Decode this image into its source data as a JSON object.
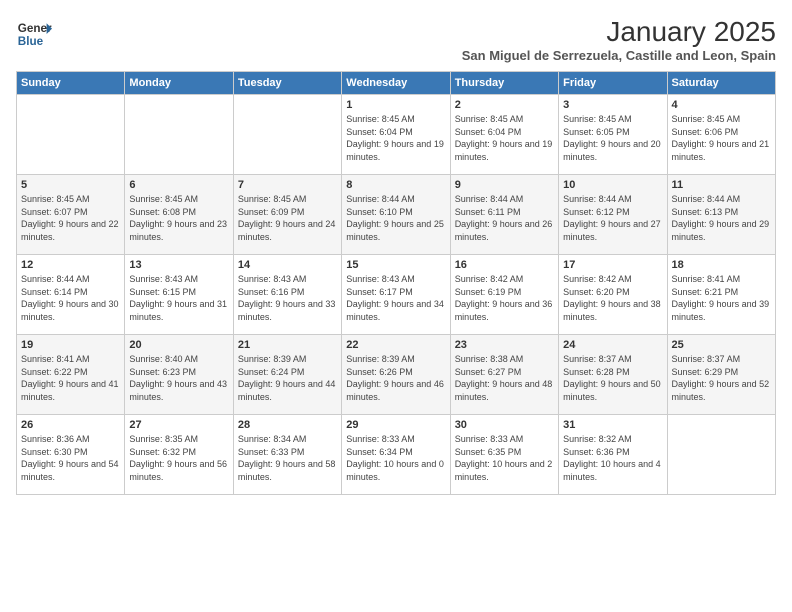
{
  "header": {
    "logo_line1": "General",
    "logo_line2": "Blue",
    "month_title": "January 2025",
    "subtitle": "San Miguel de Serrezuela, Castille and Leon, Spain"
  },
  "days_of_week": [
    "Sunday",
    "Monday",
    "Tuesday",
    "Wednesday",
    "Thursday",
    "Friday",
    "Saturday"
  ],
  "weeks": [
    [
      {
        "day": "",
        "info": ""
      },
      {
        "day": "",
        "info": ""
      },
      {
        "day": "",
        "info": ""
      },
      {
        "day": "1",
        "info": "Sunrise: 8:45 AM\nSunset: 6:04 PM\nDaylight: 9 hours and 19 minutes."
      },
      {
        "day": "2",
        "info": "Sunrise: 8:45 AM\nSunset: 6:04 PM\nDaylight: 9 hours and 19 minutes."
      },
      {
        "day": "3",
        "info": "Sunrise: 8:45 AM\nSunset: 6:05 PM\nDaylight: 9 hours and 20 minutes."
      },
      {
        "day": "4",
        "info": "Sunrise: 8:45 AM\nSunset: 6:06 PM\nDaylight: 9 hours and 21 minutes."
      }
    ],
    [
      {
        "day": "5",
        "info": "Sunrise: 8:45 AM\nSunset: 6:07 PM\nDaylight: 9 hours and 22 minutes."
      },
      {
        "day": "6",
        "info": "Sunrise: 8:45 AM\nSunset: 6:08 PM\nDaylight: 9 hours and 23 minutes."
      },
      {
        "day": "7",
        "info": "Sunrise: 8:45 AM\nSunset: 6:09 PM\nDaylight: 9 hours and 24 minutes."
      },
      {
        "day": "8",
        "info": "Sunrise: 8:44 AM\nSunset: 6:10 PM\nDaylight: 9 hours and 25 minutes."
      },
      {
        "day": "9",
        "info": "Sunrise: 8:44 AM\nSunset: 6:11 PM\nDaylight: 9 hours and 26 minutes."
      },
      {
        "day": "10",
        "info": "Sunrise: 8:44 AM\nSunset: 6:12 PM\nDaylight: 9 hours and 27 minutes."
      },
      {
        "day": "11",
        "info": "Sunrise: 8:44 AM\nSunset: 6:13 PM\nDaylight: 9 hours and 29 minutes."
      }
    ],
    [
      {
        "day": "12",
        "info": "Sunrise: 8:44 AM\nSunset: 6:14 PM\nDaylight: 9 hours and 30 minutes."
      },
      {
        "day": "13",
        "info": "Sunrise: 8:43 AM\nSunset: 6:15 PM\nDaylight: 9 hours and 31 minutes."
      },
      {
        "day": "14",
        "info": "Sunrise: 8:43 AM\nSunset: 6:16 PM\nDaylight: 9 hours and 33 minutes."
      },
      {
        "day": "15",
        "info": "Sunrise: 8:43 AM\nSunset: 6:17 PM\nDaylight: 9 hours and 34 minutes."
      },
      {
        "day": "16",
        "info": "Sunrise: 8:42 AM\nSunset: 6:19 PM\nDaylight: 9 hours and 36 minutes."
      },
      {
        "day": "17",
        "info": "Sunrise: 8:42 AM\nSunset: 6:20 PM\nDaylight: 9 hours and 38 minutes."
      },
      {
        "day": "18",
        "info": "Sunrise: 8:41 AM\nSunset: 6:21 PM\nDaylight: 9 hours and 39 minutes."
      }
    ],
    [
      {
        "day": "19",
        "info": "Sunrise: 8:41 AM\nSunset: 6:22 PM\nDaylight: 9 hours and 41 minutes."
      },
      {
        "day": "20",
        "info": "Sunrise: 8:40 AM\nSunset: 6:23 PM\nDaylight: 9 hours and 43 minutes."
      },
      {
        "day": "21",
        "info": "Sunrise: 8:39 AM\nSunset: 6:24 PM\nDaylight: 9 hours and 44 minutes."
      },
      {
        "day": "22",
        "info": "Sunrise: 8:39 AM\nSunset: 6:26 PM\nDaylight: 9 hours and 46 minutes."
      },
      {
        "day": "23",
        "info": "Sunrise: 8:38 AM\nSunset: 6:27 PM\nDaylight: 9 hours and 48 minutes."
      },
      {
        "day": "24",
        "info": "Sunrise: 8:37 AM\nSunset: 6:28 PM\nDaylight: 9 hours and 50 minutes."
      },
      {
        "day": "25",
        "info": "Sunrise: 8:37 AM\nSunset: 6:29 PM\nDaylight: 9 hours and 52 minutes."
      }
    ],
    [
      {
        "day": "26",
        "info": "Sunrise: 8:36 AM\nSunset: 6:30 PM\nDaylight: 9 hours and 54 minutes."
      },
      {
        "day": "27",
        "info": "Sunrise: 8:35 AM\nSunset: 6:32 PM\nDaylight: 9 hours and 56 minutes."
      },
      {
        "day": "28",
        "info": "Sunrise: 8:34 AM\nSunset: 6:33 PM\nDaylight: 9 hours and 58 minutes."
      },
      {
        "day": "29",
        "info": "Sunrise: 8:33 AM\nSunset: 6:34 PM\nDaylight: 10 hours and 0 minutes."
      },
      {
        "day": "30",
        "info": "Sunrise: 8:33 AM\nSunset: 6:35 PM\nDaylight: 10 hours and 2 minutes."
      },
      {
        "day": "31",
        "info": "Sunrise: 8:32 AM\nSunset: 6:36 PM\nDaylight: 10 hours and 4 minutes."
      },
      {
        "day": "",
        "info": ""
      }
    ]
  ]
}
